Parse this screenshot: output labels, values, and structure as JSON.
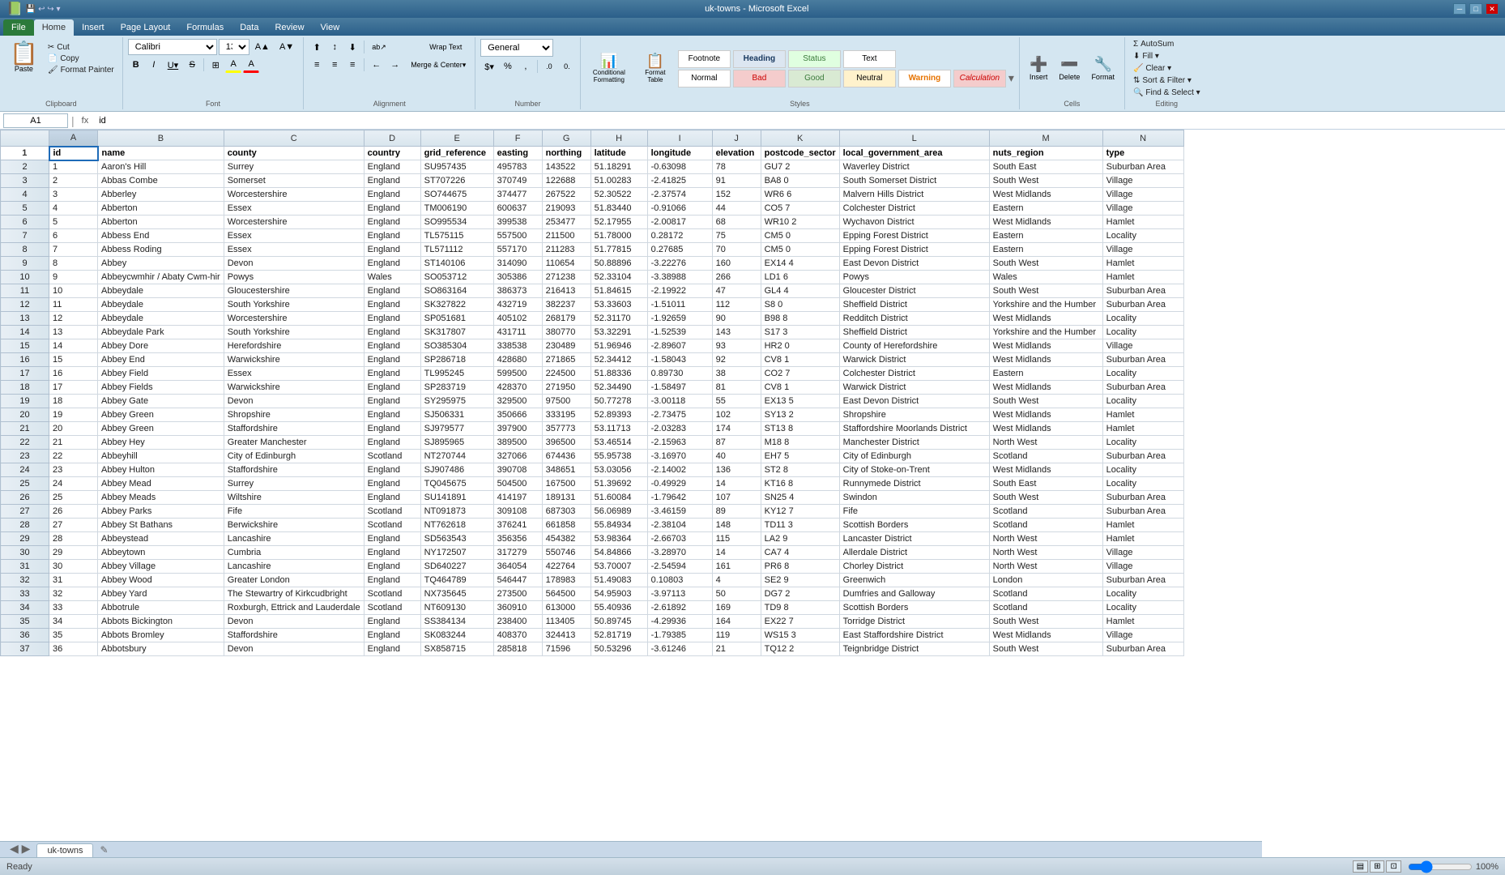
{
  "titleBar": {
    "title": "uk-towns - Microsoft Excel",
    "minimize": "─",
    "restore": "□",
    "close": "✕"
  },
  "quickAccess": {
    "buttons": [
      "💾",
      "↩",
      "↪",
      "▾"
    ]
  },
  "ribbonTabs": [
    "File",
    "Home",
    "Insert",
    "Page Layout",
    "Formulas",
    "Data",
    "Review",
    "View"
  ],
  "activeTab": "Home",
  "ribbon": {
    "clipboard": {
      "label": "Clipboard",
      "paste": "Paste",
      "cut": "Cut",
      "copy": "Copy",
      "formatPainter": "Format Painter"
    },
    "font": {
      "label": "Font",
      "fontName": "Calibri",
      "fontSize": "13",
      "bold": "B",
      "italic": "I",
      "underline": "U",
      "strikethrough": "S̶",
      "border": "⊞",
      "fillColor": "A",
      "fontColor": "A"
    },
    "alignment": {
      "label": "Alignment",
      "wrapText": "Wrap Text",
      "mergeCenter": "Merge & Center",
      "topAlign": "⊤",
      "middleAlign": "≡",
      "bottomAlign": "⊥",
      "leftAlign": "≡",
      "centerAlign": "≡",
      "rightAlign": "≡",
      "increaseIndent": "→",
      "decreaseIndent": "←",
      "orientation": "ab"
    },
    "number": {
      "label": "Number",
      "format": "General",
      "currency": "$",
      "percent": "%",
      "comma": ",",
      "increaseDecimal": ".0",
      "decreaseDecimal": "0."
    },
    "styles": {
      "label": "Styles",
      "conditionalFormatting": "Conditional Formatting",
      "formatAsTable": "Format Table",
      "cells": {
        "footnote": "Footnote",
        "heading": "Heading",
        "status": "Status",
        "text": "Text",
        "normal": "Normal",
        "bad": "Bad",
        "good": "Good",
        "neutral": "Neutral",
        "warning": "Warning",
        "calculation": "Calculation"
      }
    },
    "cells": {
      "label": "Cells",
      "insert": "Insert",
      "delete": "Delete",
      "format": "Format"
    },
    "editing": {
      "label": "Editing",
      "autoSum": "AutoSum",
      "fill": "Fill ▾",
      "clear": "Clear ▾",
      "sortFilter": "Sort & Filter ▾",
      "findSelect": "Find & Select ▾"
    }
  },
  "formulaBar": {
    "nameBox": "A1",
    "funcBtn": "fx",
    "formula": "id"
  },
  "columns": [
    "A",
    "B",
    "C",
    "D",
    "E",
    "F",
    "G",
    "H",
    "I",
    "J",
    "K",
    "L",
    "M",
    "N"
  ],
  "headers": [
    "id",
    "name",
    "county",
    "country",
    "grid_reference",
    "easting",
    "northing",
    "latitude",
    "longitude",
    "elevation",
    "postcode_sector",
    "local_government_area",
    "nuts_region",
    "type"
  ],
  "rows": [
    [
      "1",
      "Aaron's Hill",
      "Surrey",
      "England",
      "SU957435",
      "495783",
      "143522",
      "51.18291",
      "-0.63098",
      "78",
      "GU7 2",
      "Waverley District",
      "South East",
      "Suburban Area"
    ],
    [
      "2",
      "Abbas Combe",
      "Somerset",
      "England",
      "ST707226",
      "370749",
      "122688",
      "51.00283",
      "-2.41825",
      "91",
      "BA8 0",
      "South Somerset District",
      "South West",
      "Village"
    ],
    [
      "3",
      "Abberley",
      "Worcestershire",
      "England",
      "SO744675",
      "374477",
      "267522",
      "52.30522",
      "-2.37574",
      "152",
      "WR6 6",
      "Malvern Hills District",
      "West Midlands",
      "Village"
    ],
    [
      "4",
      "Abberton",
      "Essex",
      "England",
      "TM006190",
      "600637",
      "219093",
      "51.83440",
      "-0.91066",
      "44",
      "CO5 7",
      "Colchester District",
      "Eastern",
      "Village"
    ],
    [
      "5",
      "Abberton",
      "Worcestershire",
      "England",
      "SO995534",
      "399538",
      "253477",
      "52.17955",
      "-2.00817",
      "68",
      "WR10 2",
      "Wychavon District",
      "West Midlands",
      "Hamlet"
    ],
    [
      "6",
      "Abbess End",
      "Essex",
      "England",
      "TL575115",
      "557500",
      "211500",
      "51.78000",
      "0.28172",
      "75",
      "CM5 0",
      "Epping Forest District",
      "Eastern",
      "Locality"
    ],
    [
      "7",
      "Abbess Roding",
      "Essex",
      "England",
      "TL571112",
      "557170",
      "211283",
      "51.77815",
      "0.27685",
      "70",
      "CM5 0",
      "Epping Forest District",
      "Eastern",
      "Village"
    ],
    [
      "8",
      "Abbey",
      "Devon",
      "England",
      "ST140106",
      "314090",
      "110654",
      "50.88896",
      "-3.22276",
      "160",
      "EX14 4",
      "East Devon District",
      "South West",
      "Hamlet"
    ],
    [
      "9",
      "Abbeycwmhir / Abaty Cwm-hir",
      "Powys",
      "Wales",
      "SO053712",
      "305386",
      "271238",
      "52.33104",
      "-3.38988",
      "266",
      "LD1 6",
      "Powys",
      "Wales",
      "Hamlet"
    ],
    [
      "10",
      "Abbeydale",
      "Gloucestershire",
      "England",
      "SO863164",
      "386373",
      "216413",
      "51.84615",
      "-2.19922",
      "47",
      "GL4 4",
      "Gloucester District",
      "South West",
      "Suburban Area"
    ],
    [
      "11",
      "Abbeydale",
      "South Yorkshire",
      "England",
      "SK327822",
      "432719",
      "382237",
      "53.33603",
      "-1.51011",
      "112",
      "S8 0",
      "Sheffield District",
      "Yorkshire and the Humber",
      "Suburban Area"
    ],
    [
      "12",
      "Abbeydale",
      "Worcestershire",
      "England",
      "SP051681",
      "405102",
      "268179",
      "52.31170",
      "-1.92659",
      "90",
      "B98 8",
      "Redditch District",
      "West Midlands",
      "Locality"
    ],
    [
      "13",
      "Abbeydale Park",
      "South Yorkshire",
      "England",
      "SK317807",
      "431711",
      "380770",
      "53.32291",
      "-1.52539",
      "143",
      "S17 3",
      "Sheffield District",
      "Yorkshire and the Humber",
      "Locality"
    ],
    [
      "14",
      "Abbey Dore",
      "Herefordshire",
      "England",
      "SO385304",
      "338538",
      "230489",
      "51.96946",
      "-2.89607",
      "93",
      "HR2 0",
      "County of Herefordshire",
      "West Midlands",
      "Village"
    ],
    [
      "15",
      "Abbey End",
      "Warwickshire",
      "England",
      "SP286718",
      "428680",
      "271865",
      "52.34412",
      "-1.58043",
      "92",
      "CV8 1",
      "Warwick District",
      "West Midlands",
      "Suburban Area"
    ],
    [
      "16",
      "Abbey Field",
      "Essex",
      "England",
      "TL995245",
      "599500",
      "224500",
      "51.88336",
      "0.89730",
      "38",
      "CO2 7",
      "Colchester District",
      "Eastern",
      "Locality"
    ],
    [
      "17",
      "Abbey Fields",
      "Warwickshire",
      "England",
      "SP283719",
      "428370",
      "271950",
      "52.34490",
      "-1.58497",
      "81",
      "CV8 1",
      "Warwick District",
      "West Midlands",
      "Suburban Area"
    ],
    [
      "18",
      "Abbey Gate",
      "Devon",
      "England",
      "SY295975",
      "329500",
      "97500",
      "50.77278",
      "-3.00118",
      "55",
      "EX13 5",
      "East Devon District",
      "South West",
      "Locality"
    ],
    [
      "19",
      "Abbey Green",
      "Shropshire",
      "England",
      "SJ506331",
      "350666",
      "333195",
      "52.89393",
      "-2.73475",
      "102",
      "SY13 2",
      "Shropshire",
      "West Midlands",
      "Hamlet"
    ],
    [
      "20",
      "Abbey Green",
      "Staffordshire",
      "England",
      "SJ979577",
      "397900",
      "357773",
      "53.11713",
      "-2.03283",
      "174",
      "ST13 8",
      "Staffordshire Moorlands District",
      "West Midlands",
      "Hamlet"
    ],
    [
      "21",
      "Abbey Hey",
      "Greater Manchester",
      "England",
      "SJ895965",
      "389500",
      "396500",
      "53.46514",
      "-2.15963",
      "87",
      "M18 8",
      "Manchester District",
      "North West",
      "Locality"
    ],
    [
      "22",
      "Abbeyhill",
      "City of Edinburgh",
      "Scotland",
      "NT270744",
      "327066",
      "674436",
      "55.95738",
      "-3.16970",
      "40",
      "EH7 5",
      "City of Edinburgh",
      "Scotland",
      "Suburban Area"
    ],
    [
      "23",
      "Abbey Hulton",
      "Staffordshire",
      "England",
      "SJ907486",
      "390708",
      "348651",
      "53.03056",
      "-2.14002",
      "136",
      "ST2 8",
      "City of Stoke-on-Trent",
      "West Midlands",
      "Locality"
    ],
    [
      "24",
      "Abbey Mead",
      "Surrey",
      "England",
      "TQ045675",
      "504500",
      "167500",
      "51.39692",
      "-0.49929",
      "14",
      "KT16 8",
      "Runnymede District",
      "South East",
      "Locality"
    ],
    [
      "25",
      "Abbey Meads",
      "Wiltshire",
      "England",
      "SU141891",
      "414197",
      "189131",
      "51.60084",
      "-1.79642",
      "107",
      "SN25 4",
      "Swindon",
      "South West",
      "Suburban Area"
    ],
    [
      "26",
      "Abbey Parks",
      "Fife",
      "Scotland",
      "NT091873",
      "309108",
      "687303",
      "56.06989",
      "-3.46159",
      "89",
      "KY12 7",
      "Fife",
      "Scotland",
      "Suburban Area"
    ],
    [
      "27",
      "Abbey St Bathans",
      "Berwickshire",
      "Scotland",
      "NT762618",
      "376241",
      "661858",
      "55.84934",
      "-2.38104",
      "148",
      "TD11 3",
      "Scottish Borders",
      "Scotland",
      "Hamlet"
    ],
    [
      "28",
      "Abbeystead",
      "Lancashire",
      "England",
      "SD563543",
      "356356",
      "454382",
      "53.98364",
      "-2.66703",
      "115",
      "LA2 9",
      "Lancaster District",
      "North West",
      "Hamlet"
    ],
    [
      "29",
      "Abbeytown",
      "Cumbria",
      "England",
      "NY172507",
      "317279",
      "550746",
      "54.84866",
      "-3.28970",
      "14",
      "CA7 4",
      "Allerdale District",
      "North West",
      "Village"
    ],
    [
      "30",
      "Abbey Village",
      "Lancashire",
      "England",
      "SD640227",
      "364054",
      "422764",
      "53.70007",
      "-2.54594",
      "161",
      "PR6 8",
      "Chorley District",
      "North West",
      "Village"
    ],
    [
      "31",
      "Abbey Wood",
      "Greater London",
      "England",
      "TQ464789",
      "546447",
      "178983",
      "51.49083",
      "0.10803",
      "4",
      "SE2 9",
      "Greenwich",
      "London",
      "Suburban Area"
    ],
    [
      "32",
      "Abbey Yard",
      "The Stewartry of Kirkcudbright",
      "Scotland",
      "NX735645",
      "273500",
      "564500",
      "54.95903",
      "-3.97113",
      "50",
      "DG7 2",
      "Dumfries and Galloway",
      "Scotland",
      "Locality"
    ],
    [
      "33",
      "Abbotrule",
      "Roxburgh, Ettrick and Lauderdale",
      "Scotland",
      "NT609130",
      "360910",
      "613000",
      "55.40936",
      "-2.61892",
      "169",
      "TD9 8",
      "Scottish Borders",
      "Scotland",
      "Locality"
    ],
    [
      "34",
      "Abbots Bickington",
      "Devon",
      "England",
      "SS384134",
      "238400",
      "113405",
      "50.89745",
      "-4.29936",
      "164",
      "EX22 7",
      "Torridge District",
      "South West",
      "Hamlet"
    ],
    [
      "35",
      "Abbots Bromley",
      "Staffordshire",
      "England",
      "SK083244",
      "408370",
      "324413",
      "52.81719",
      "-1.79385",
      "119",
      "WS15 3",
      "East Staffordshire District",
      "West Midlands",
      "Village"
    ],
    [
      "36",
      "Abbotsbury",
      "Devon",
      "England",
      "SX858715",
      "285818",
      "71596",
      "50.53296",
      "-3.61246",
      "21",
      "TQ12 2",
      "Teignbridge District",
      "South West",
      "Suburban Area"
    ]
  ],
  "sheetTabs": [
    "uk-towns"
  ],
  "statusBar": {
    "status": "Ready",
    "zoom": "100%",
    "zoomIcon": "🔍"
  }
}
